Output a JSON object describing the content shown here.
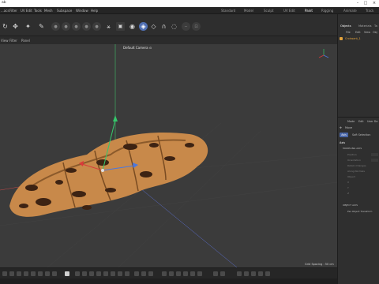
{
  "titlebar": {
    "title": "ab"
  },
  "menu": {
    "items": [
      "...acs",
      "Filter",
      "UV Edit",
      "Tools",
      "Mesh",
      "Subspace",
      "Window",
      "Help"
    ],
    "workspaces": [
      "Standard",
      "Model",
      "Sculpt",
      "UV Edit",
      "Paint",
      "Rigging",
      "Animate",
      "Track"
    ],
    "active_workspace": "Paint"
  },
  "viewport": {
    "header_items": [
      "View",
      "Filter",
      "Panel"
    ],
    "camera": "Default Camera ⊙",
    "grid_spacing": "Grid Spacing : 50 cm"
  },
  "objects_panel": {
    "tabs": [
      "Objects",
      "Materials",
      "Ta"
    ],
    "menu": [
      "File",
      "Edit",
      "View",
      "Obj"
    ],
    "item": "Croissant_1"
  },
  "attributes_panel": {
    "menu": [
      "Mode",
      "Edit",
      "User Da"
    ],
    "title": "Move",
    "tabs": [
      "Axis",
      "Soft Selection"
    ],
    "active_tab": "Axis",
    "section": "Axis",
    "subsection_modeling": "MODELING AXIS",
    "fields": [
      "Position",
      "Orientation",
      "Retain Changes",
      "Along Normals",
      "Object",
      "X",
      "Y",
      "Z"
    ],
    "subsection_object": "OBJECT AXIS",
    "object_axis_value": "Per-Object Transform"
  },
  "colors": {
    "viewport_bg": "#3b3b3b",
    "panel_bg": "#2f2f2f",
    "accent": "#4a67a8",
    "axis_x": "#d93a3a",
    "axis_y": "#35c76b",
    "axis_z": "#4a78e0"
  }
}
